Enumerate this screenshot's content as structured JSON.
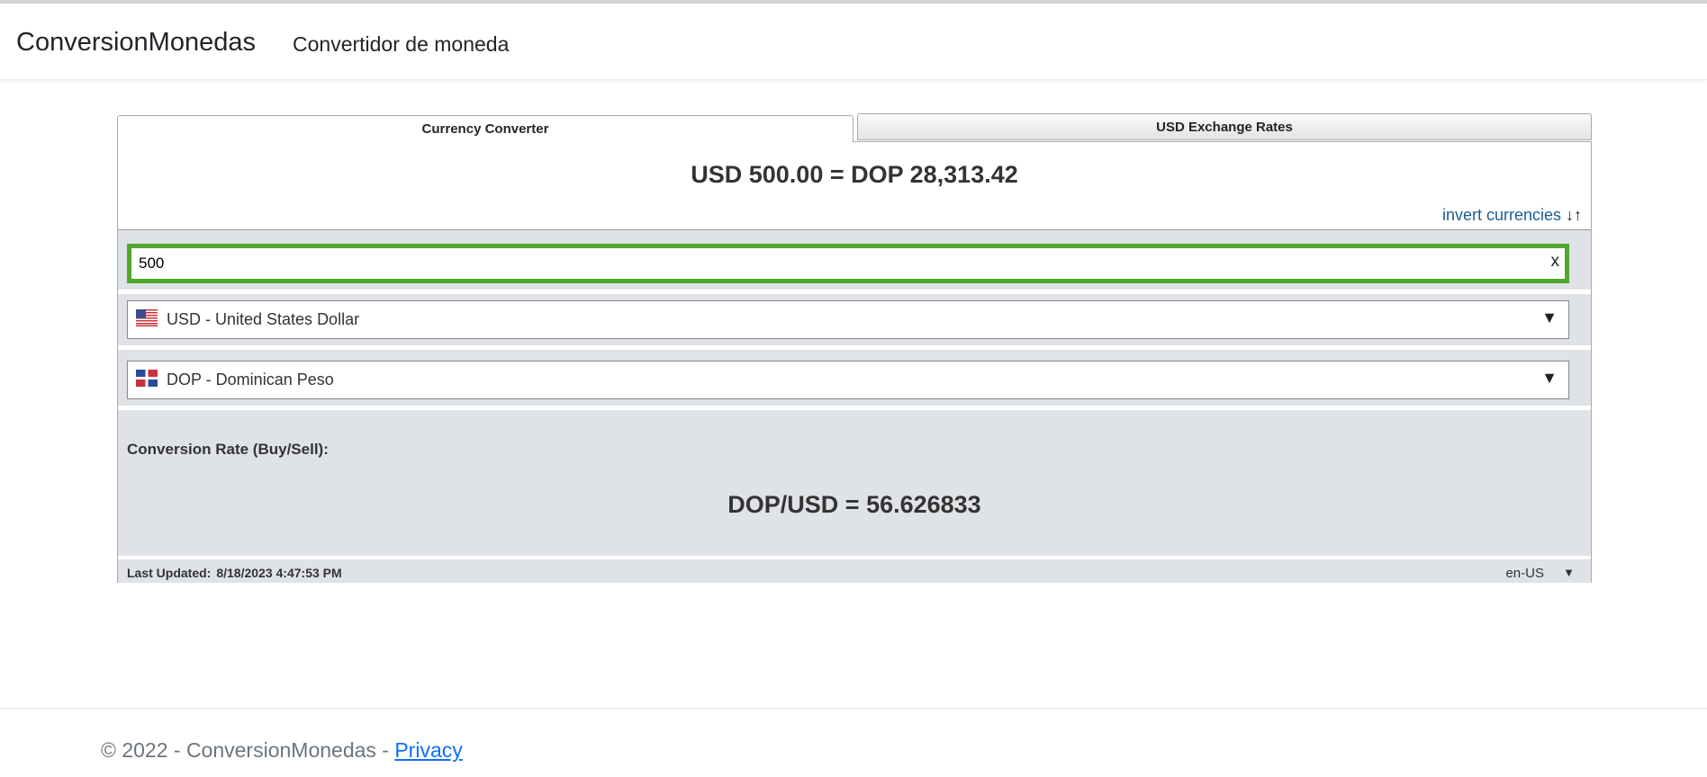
{
  "navbar": {
    "brand": "ConversionMonedas",
    "link": "Convertidor de moneda"
  },
  "tabs": [
    {
      "label": "Currency Converter",
      "active": true
    },
    {
      "label": "USD Exchange Rates",
      "active": false
    }
  ],
  "converter": {
    "result_text": "USD 500.00 = DOP 28,313.42",
    "invert_label": "invert currencies",
    "invert_icon": "↓↑",
    "amount_value": "500",
    "clear_label": "x",
    "from_currency": "USD - United States Dollar",
    "to_currency": "DOP - Dominican Peso",
    "caret": "▼",
    "rate_label": "Conversion Rate (Buy/Sell):",
    "rate_value": "DOP/USD = 56.626833",
    "last_updated_label": "Last Updated:",
    "last_updated_value": "8/18/2023 4:47:53 PM",
    "locale": "en-US",
    "locale_caret": "▼"
  },
  "colors": {
    "accent_border": "#51a72c",
    "link": "#1a5d96",
    "panel_gray": "#dfe2e6"
  },
  "footer": {
    "copyright": "© 2022 - ConversionMonedas - ",
    "privacy_link": "Privacy"
  }
}
